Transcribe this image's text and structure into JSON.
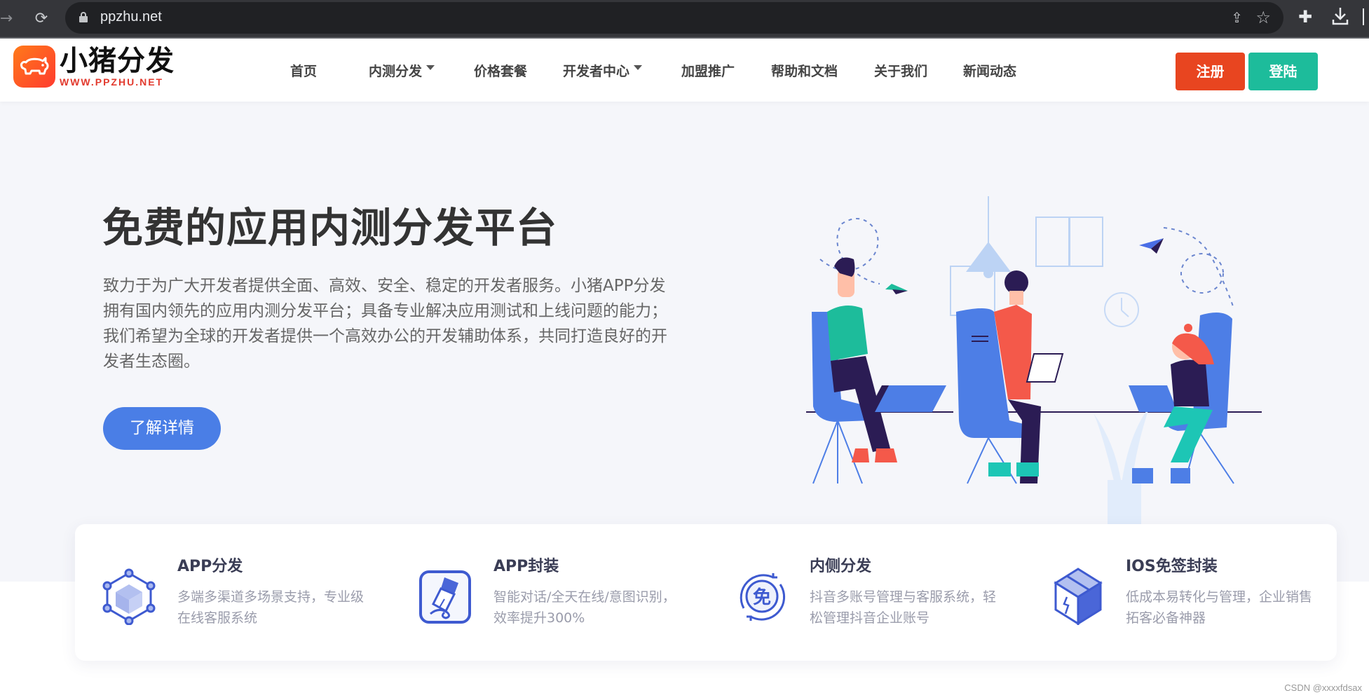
{
  "browser": {
    "url": "ppzhu.net",
    "icons": [
      "back-arrow-icon",
      "reload-icon",
      "lock-icon",
      "share-icon",
      "star-icon",
      "extensions-icon",
      "download-icon"
    ]
  },
  "header": {
    "logo_cn": "小猪分发",
    "logo_en": "WWW.PPZHU.NET",
    "menu": [
      {
        "label": "首页",
        "dropdown": false
      },
      {
        "label": "内测分发",
        "dropdown": true
      },
      {
        "label": "价格套餐",
        "dropdown": false
      },
      {
        "label": "开发者中心",
        "dropdown": true
      },
      {
        "label": "加盟推广",
        "dropdown": false
      },
      {
        "label": "帮助和文档",
        "dropdown": false
      },
      {
        "label": "关于我们",
        "dropdown": false
      },
      {
        "label": "新闻动态",
        "dropdown": false
      }
    ],
    "register_label": "注册",
    "login_label": "登陆",
    "colors": {
      "register": "#e84520",
      "login": "#1dbc9b"
    }
  },
  "hero": {
    "title": "免费的应用内测分发平台",
    "description": "致力于为广大开发者提供全面、高效、安全、稳定的开发者服务。小猪APP分发拥有国内领先的应用内测分发平台；具备专业解决应用测试和上线问题的能力；我们希望为全球的开发者提供一个高效办公的开发辅助体系，共同打造良好的开发者生态圈。",
    "button_label": "了解详情",
    "accent": "#4a7ee6"
  },
  "features": [
    {
      "icon": "network-cube-icon",
      "title": "APP分发",
      "desc": "多端多渠道多场景支持，专业级在线客服系统"
    },
    {
      "icon": "pen-nib-icon",
      "title": "APP封装",
      "desc": "智能对话/全天在线/意图识别，效率提升300%"
    },
    {
      "icon": "free-cycle-icon",
      "title": "内侧分发",
      "desc": "抖音多账号管理与客服系统，轻松管理抖音企业账号"
    },
    {
      "icon": "box-package-icon",
      "title": "IOS免签封装",
      "desc": "低成本易转化与管理，企业销售拓客必备神器"
    }
  ],
  "watermark": "CSDN @xxxxfdsax"
}
